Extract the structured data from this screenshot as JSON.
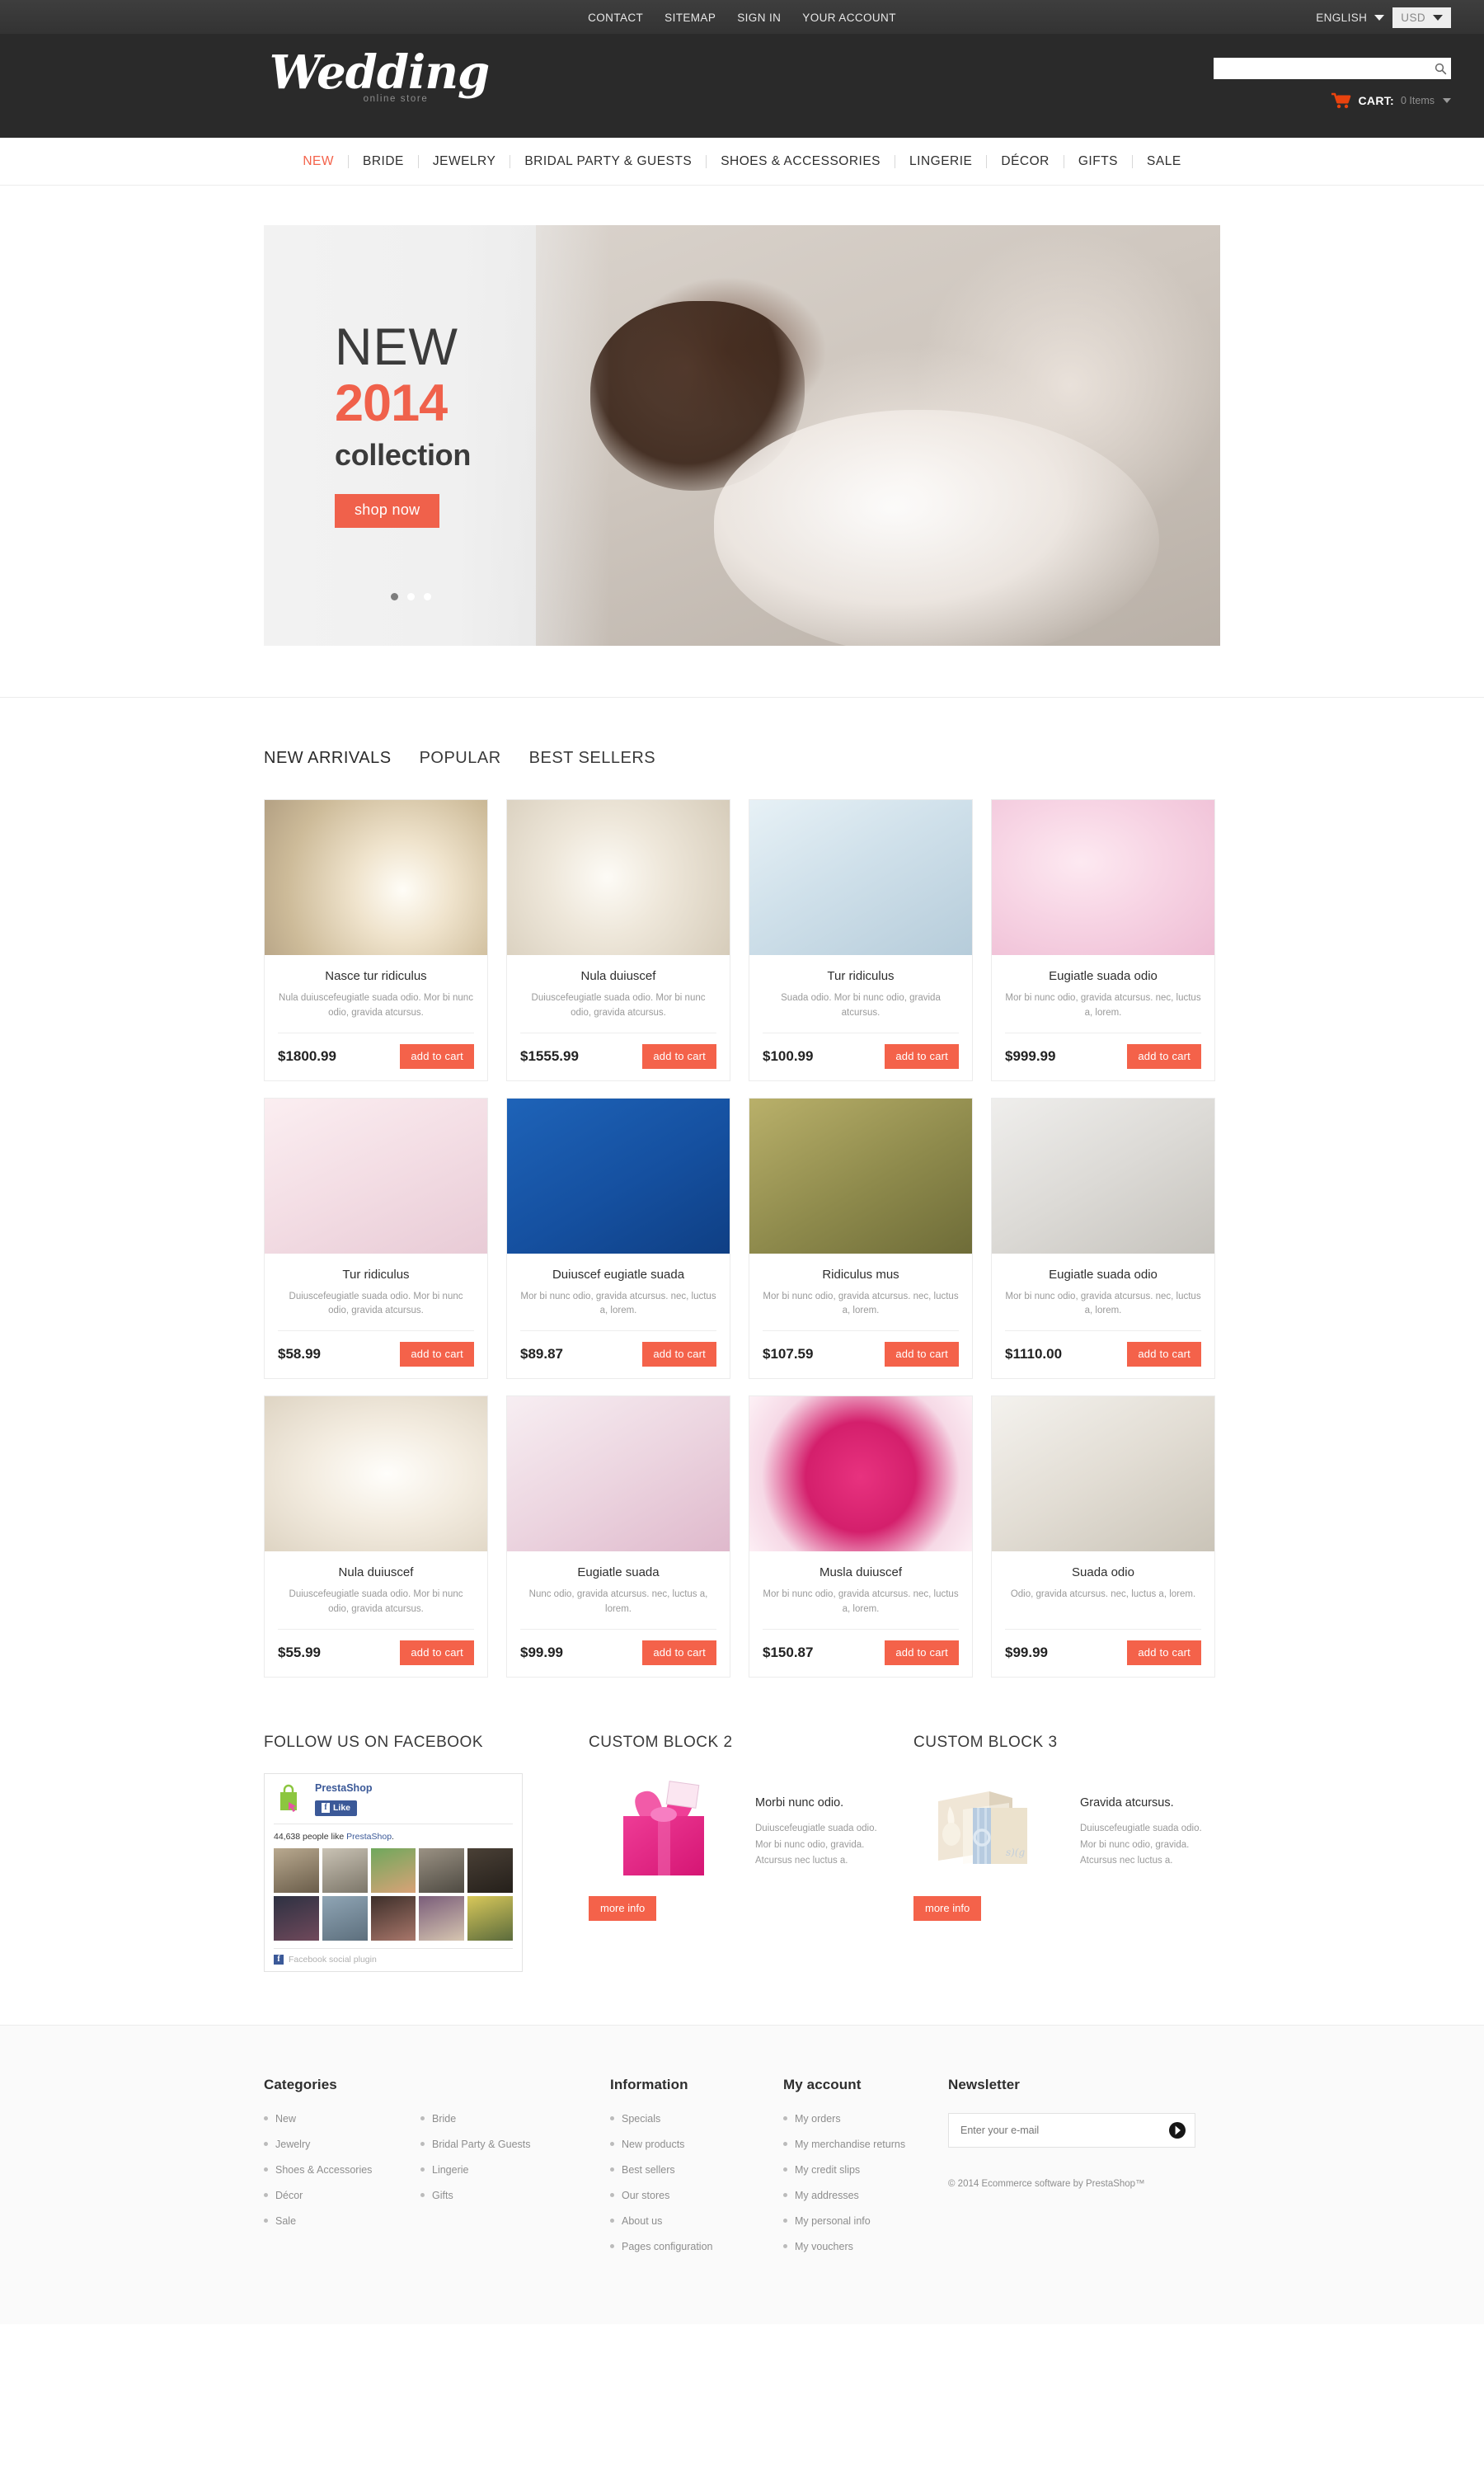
{
  "topbar": {
    "links": [
      "CONTACT",
      "SITEMAP",
      "SIGN IN",
      "YOUR ACCOUNT"
    ],
    "language": "ENGLISH",
    "currency": "USD"
  },
  "header": {
    "logo_word": "Wedding",
    "logo_tagline": "online store",
    "search_placeholder": "",
    "search_value": "",
    "cart_label": "CART:",
    "cart_count": "0 Items"
  },
  "nav": {
    "items": [
      {
        "label": "NEW",
        "active": true
      },
      {
        "label": "BRIDE",
        "active": false
      },
      {
        "label": "JEWELRY",
        "active": false
      },
      {
        "label": "BRIDAL PARTY & GUESTS",
        "active": false
      },
      {
        "label": "SHOES & ACCESSORIES",
        "active": false
      },
      {
        "label": "LINGERIE",
        "active": false
      },
      {
        "label": "DÉCOR",
        "active": false
      },
      {
        "label": "GIFTS",
        "active": false
      },
      {
        "label": "SALE",
        "active": false
      }
    ]
  },
  "slider": {
    "line1": "NEW",
    "line2": "2014",
    "line3": "collection",
    "button": "shop now",
    "slides": 3,
    "active_slide": 1,
    "accent_color": "#f0614b"
  },
  "tabs": [
    {
      "label": "NEW ARRIVALS",
      "active": true
    },
    {
      "label": "POPULAR",
      "active": false
    },
    {
      "label": "BEST SELLERS",
      "active": false
    }
  ],
  "add_to_cart_label": "add to cart",
  "products": [
    {
      "title": "Nasce tur ridiculus",
      "desc": "Nula duiuscefeugiatle suada odio. Mor bi nunc odio, gravida atcursus.",
      "price": "$1800.99",
      "img": "ring-on-gold-fabric"
    },
    {
      "title": "Nula duiuscef",
      "desc": "Duiuscefeugiatle suada odio. Mor bi nunc odio, gravida atcursus.",
      "price": "$1555.99",
      "img": "two-gold-rings"
    },
    {
      "title": "Tur ridiculus",
      "desc": "Suada odio.  Mor bi nunc odio, gravida atcursus.",
      "price": "$100.99",
      "img": "blue-ring-pillows"
    },
    {
      "title": "Eugiatle suada odio",
      "desc": "Mor bi nunc odio, gravida atcursus. nec, luctus a, lorem.",
      "price": "$999.99",
      "img": "bride-pink-flowers"
    },
    {
      "title": "Tur ridiculus",
      "desc": "Duiuscefeugiatle suada odio. Mor bi nunc odio, gravida atcursus.",
      "price": "$58.99",
      "img": "pink-favor-boxes"
    },
    {
      "title": "Duiuscef eugiatle suada",
      "desc": "Mor bi nunc odio, gravida atcursus. nec, luctus a, lorem.",
      "price": "$89.87",
      "img": "blue-invitation-glasses"
    },
    {
      "title": "Ridiculus mus",
      "desc": "Mor bi nunc odio, gravida atcursus. nec, luctus a, lorem.",
      "price": "$107.59",
      "img": "green-favor-boxes"
    },
    {
      "title": "Eugiatle suada odio",
      "desc": "Mor bi nunc odio, gravida atcursus. nec, luctus a, lorem.",
      "price": "$1110.00",
      "img": "bride-white-dress"
    },
    {
      "title": "Nula duiuscef",
      "desc": "Duiuscefeugiatle suada odio. Mor bi nunc odio, gravida atcursus.",
      "price": "$55.99",
      "img": "white-flower-petals"
    },
    {
      "title": "Eugiatle suada",
      "desc": "Nunc odio, gravida atcursus. nec, luctus a, lorem.",
      "price": "$99.99",
      "img": "pink-tulips-hanger"
    },
    {
      "title": "Musla duiuscef",
      "desc": "Mor bi nunc odio, gravida atcursus. nec, luctus a, lorem.",
      "price": "$150.87",
      "img": "pink-fabric-flower"
    },
    {
      "title": "Suada odio",
      "desc": "Odio, gravida atcursus. nec, luctus a, lorem.",
      "price": "$99.99",
      "img": "silver-ring-pillow"
    }
  ],
  "facebook_block": {
    "heading": "FOLLOW US ON FACEBOOK",
    "page_name": "PrestaShop",
    "like_label": "Like",
    "count_text": "44,638 people like",
    "count_link": "PrestaShop",
    "count_suffix": ".",
    "plugin_label": "Facebook social plugin"
  },
  "custom_block_2": {
    "heading": "CUSTOM BLOCK 2",
    "title": "Morbi nunc odio.",
    "desc": "Duiuscefeugiatle suada odio. Mor bi nunc odio, gravida. Atcursus nec luctus a.",
    "button": "more info",
    "img": "pink-gift-box"
  },
  "custom_block_3": {
    "heading": "CUSTOM BLOCK 3",
    "title": "Gravida atcursus.",
    "desc": "Duiuscefeugiatle suada odio. Mor bi nunc odio, gravida. Atcursus nec luctus a.",
    "button": "more info",
    "img": "wedding-guest-books"
  },
  "footer": {
    "categories": {
      "title": "Categories",
      "col1": [
        "New",
        "Jewelry",
        "Shoes & Accessories",
        "Décor",
        "Sale"
      ],
      "col2": [
        "Bride",
        "Bridal Party & Guests",
        "Lingerie",
        "Gifts"
      ]
    },
    "information": {
      "title": "Information",
      "items": [
        "Specials",
        "New products",
        "Best sellers",
        "Our stores",
        "About us",
        "Pages configuration"
      ]
    },
    "my_account": {
      "title": "My account",
      "items": [
        "My orders",
        "My merchandise returns",
        "My credit slips",
        "My addresses",
        "My personal info",
        "My vouchers"
      ]
    },
    "newsletter": {
      "title": "Newsletter",
      "placeholder": "Enter your e-mail",
      "value": ""
    },
    "copyright": "© 2014 Ecommerce software by PrestaShop™"
  }
}
